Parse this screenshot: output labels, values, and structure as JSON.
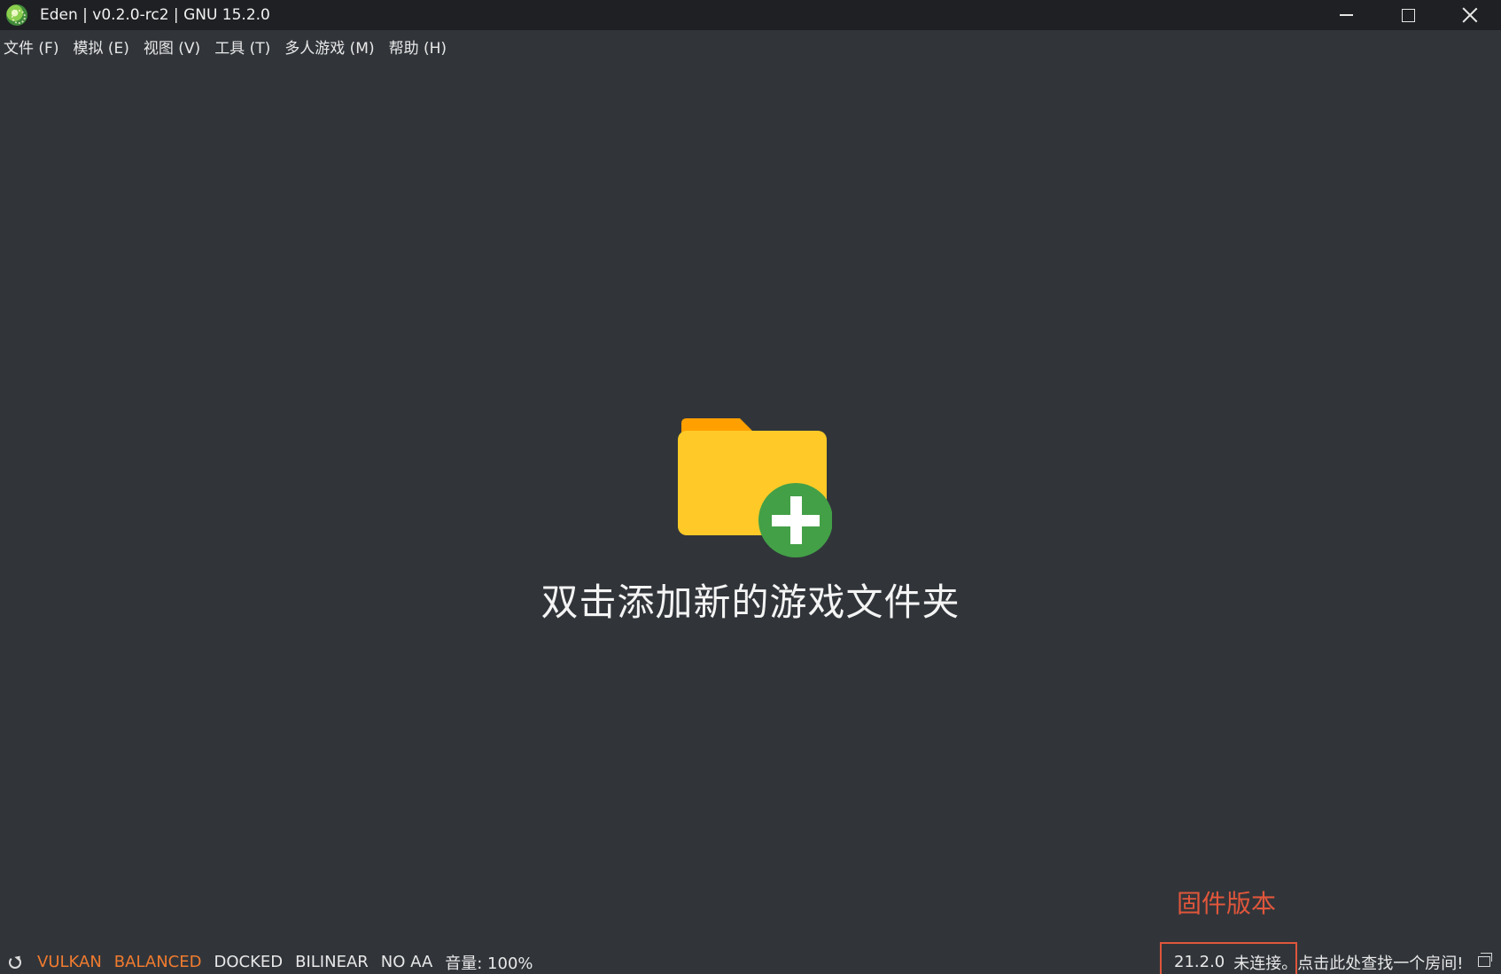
{
  "window": {
    "title": "Eden | v0.2.0-rc2 | GNU 15.2.0",
    "icons": {
      "app": "eden-logo-icon",
      "minimize": "minimize-icon",
      "maximize": "maximize-icon",
      "close": "close-icon"
    }
  },
  "menu": [
    {
      "id": "file",
      "label": "文件 (F)"
    },
    {
      "id": "emulation",
      "label": "模拟 (E)"
    },
    {
      "id": "view",
      "label": "视图 (V)"
    },
    {
      "id": "tools",
      "label": "工具 (T)"
    },
    {
      "id": "multiplayer",
      "label": "多人游戏 (M)"
    },
    {
      "id": "help",
      "label": "帮助 (H)"
    }
  ],
  "placeholder": {
    "icon": "add-folder-icon",
    "text": "双击添加新的游戏文件夹"
  },
  "annotation": {
    "label": "固件版本",
    "color": "#e0563b"
  },
  "statusbar": {
    "refresh_icon": "refresh-icon",
    "items": [
      {
        "id": "renderer",
        "label": "VULKAN",
        "color": "#f07b2f"
      },
      {
        "id": "gpu-accuracy",
        "label": "BALANCED",
        "color": "#f07b2f"
      },
      {
        "id": "dock-mode",
        "label": "DOCKED"
      },
      {
        "id": "filter",
        "label": "BILINEAR"
      },
      {
        "id": "aa",
        "label": "NO AA"
      },
      {
        "id": "volume",
        "label": "音量: 100%"
      }
    ],
    "firmware_version": "21.2.0",
    "connection_status": "未连接。",
    "room_link": "点击此处查找一个房间!",
    "room_icon": "multiplayer-room-icon"
  },
  "colors": {
    "background": "#31353a",
    "titlebar": "#1f2023",
    "folder_body": "#ffca28",
    "folder_tab": "#ffa000",
    "plus_circle": "#43a047"
  }
}
